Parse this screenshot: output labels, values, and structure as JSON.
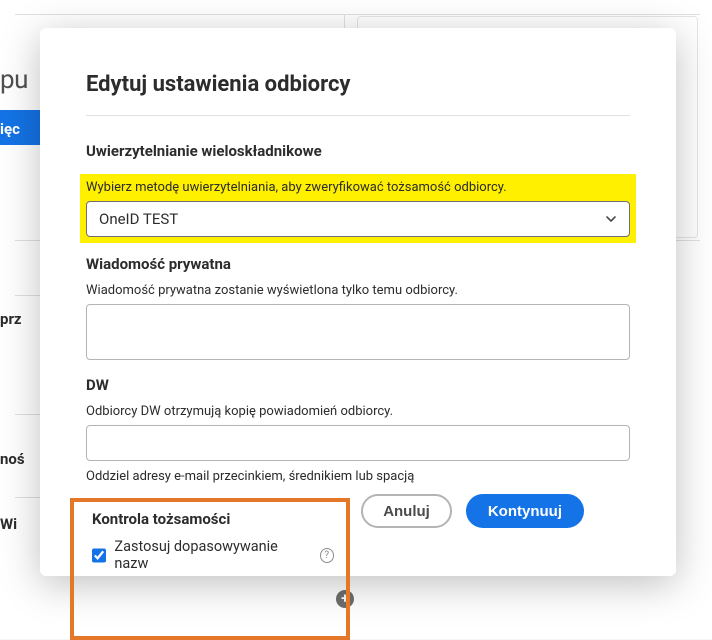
{
  "bg": {
    "left_text_fragment": "pu",
    "blue_tab_fragment": "ięc",
    "side_prz": "prz",
    "side_nos": "noś",
    "side_wi": "Wi"
  },
  "modal": {
    "title": "Edytuj ustawienia odbiorcy",
    "mfa": {
      "heading": "Uwierzytelnianie wieloskładnikowe",
      "help": "Wybierz metodę uwierzytelniania, aby zweryfikować tożsamość odbiorcy.",
      "selected_value": "OneID TEST"
    },
    "private_message": {
      "heading": "Wiadomość prywatna",
      "help": "Wiadomość prywatna zostanie wyświetlona tylko temu odbiorcy.",
      "value": ""
    },
    "dw": {
      "heading": "DW",
      "help": "Odbiorcy DW otrzymują kopię powiadomień odbiorcy.",
      "value": "",
      "tiny_help": "Oddziel adresy e-mail przecinkiem, średnikiem lub spacją"
    },
    "identity": {
      "heading": "Kontrola tożsamości",
      "checkbox_checked": true,
      "checkbox_label": "Zastosuj dopasowywanie nazw"
    },
    "buttons": {
      "cancel": "Anuluj",
      "continue": "Kontynuuj"
    }
  }
}
